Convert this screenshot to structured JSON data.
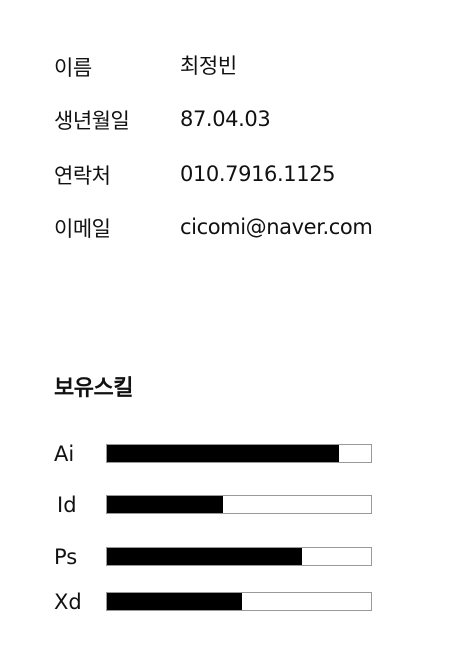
{
  "profile": {
    "rows": [
      {
        "label": "이름",
        "value": "최정빈"
      },
      {
        "label": "생년월일",
        "value": "87.04.03"
      },
      {
        "label": "연락처",
        "value": "010.7916.1125"
      },
      {
        "label": "이메일",
        "value": "cicomi@naver.com"
      }
    ]
  },
  "skills": {
    "title": "보유스킬",
    "items": [
      {
        "name": "Ai",
        "level": 0.88
      },
      {
        "name": "Id",
        "level": 0.44
      },
      {
        "name": "Ps",
        "level": 0.74
      },
      {
        "name": "Xd",
        "level": 0.51
      }
    ]
  }
}
